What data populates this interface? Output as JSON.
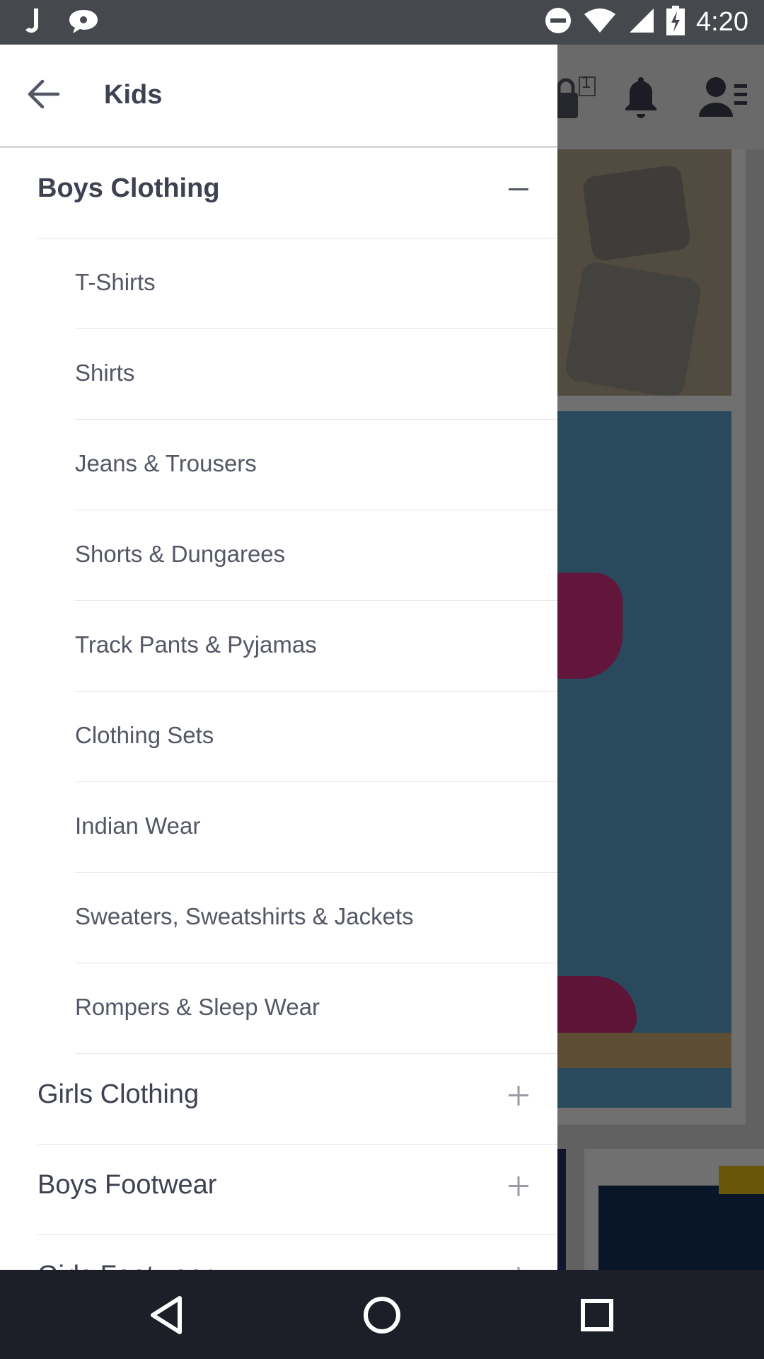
{
  "status_bar": {
    "time": "4:20",
    "icons": [
      "j-app-icon",
      "chat-bubble-icon",
      "do-not-disturb-icon",
      "wifi-icon",
      "signal-icon",
      "battery-charging-icon"
    ]
  },
  "background_header": {
    "bag_count": "1",
    "icons": [
      "bag-icon",
      "bell-icon",
      "profile-icon"
    ]
  },
  "drawer": {
    "title": "Kids",
    "sections": [
      {
        "label": "Boys Clothing",
        "expanded": true,
        "toggle": "minus-icon",
        "items": [
          "T-Shirts",
          "Shirts",
          "Jeans & Trousers",
          "Shorts & Dungarees",
          "Track Pants & Pyjamas",
          "Clothing Sets",
          "Indian Wear",
          "Sweaters, Sweatshirts & Jackets",
          "Rompers & Sleep Wear"
        ]
      },
      {
        "label": "Girls Clothing",
        "expanded": false,
        "toggle": "plus-icon"
      },
      {
        "label": "Boys Footwear",
        "expanded": false,
        "toggle": "plus-icon"
      },
      {
        "label": "Girls Footwear",
        "expanded": false,
        "toggle": "plus-icon"
      }
    ]
  },
  "nav_bar": {
    "buttons": [
      "back-triangle-icon",
      "home-circle-icon",
      "recents-square-icon"
    ]
  },
  "colors": {
    "status_bar": "#45484d",
    "nav_bar": "#1c1e28",
    "heading_text": "#3e4152",
    "item_text": "#535766",
    "divider": "#e6e6e6"
  }
}
